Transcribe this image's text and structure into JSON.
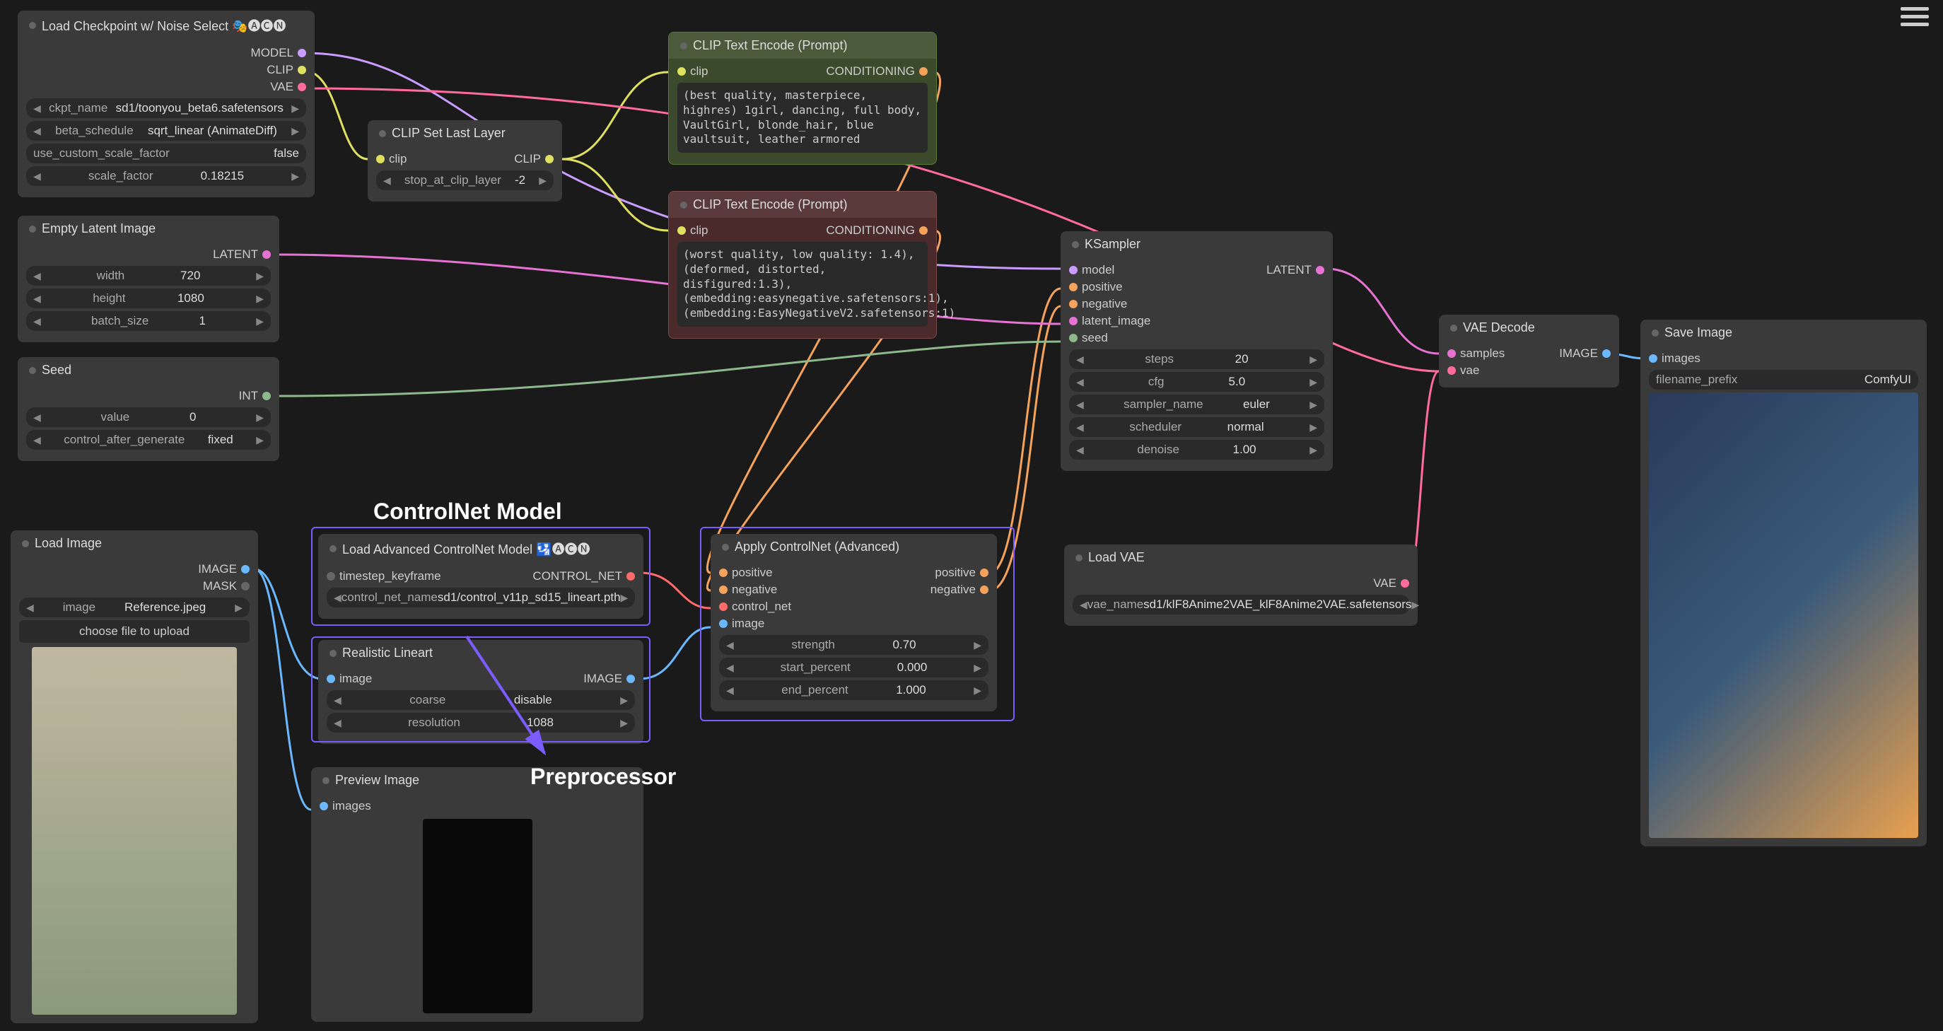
{
  "annotations": {
    "controlnet": "ControlNet Model",
    "preprocessor": "Preprocessor"
  },
  "nodes": {
    "loadckpt": {
      "title": "Load Checkpoint w/ Noise Select 🎭🅐🅒🅝",
      "outputs": [
        "MODEL",
        "CLIP",
        "VAE"
      ],
      "widgets": [
        {
          "label": "ckpt_name",
          "value": "sd1/toonyou_beta6.safetensors"
        },
        {
          "label": "beta_schedule",
          "value": "sqrt_linear (AnimateDiff)"
        },
        {
          "label": "use_custom_scale_factor",
          "value": "false"
        },
        {
          "label": "scale_factor",
          "value": "0.18215"
        }
      ]
    },
    "empty": {
      "title": "Empty Latent Image",
      "outputs": [
        "LATENT"
      ],
      "widgets": [
        {
          "label": "width",
          "value": "720"
        },
        {
          "label": "height",
          "value": "1080"
        },
        {
          "label": "batch_size",
          "value": "1"
        }
      ]
    },
    "seed": {
      "title": "Seed",
      "outputs": [
        "INT"
      ],
      "widgets": [
        {
          "label": "value",
          "value": "0"
        },
        {
          "label": "control_after_generate",
          "value": "fixed"
        }
      ]
    },
    "clipset": {
      "title": "CLIP Set Last Layer",
      "inputs": [
        "clip"
      ],
      "outputs": [
        "CLIP"
      ],
      "widgets": [
        {
          "label": "stop_at_clip_layer",
          "value": "-2"
        }
      ]
    },
    "clippos": {
      "title": "CLIP Text Encode (Prompt)",
      "inputs": [
        "clip"
      ],
      "outputs": [
        "CONDITIONING"
      ],
      "text": "(best quality, masterpiece, highres) 1girl, dancing, full body, VaultGirl, blonde_hair, blue vaultsuit, leather armored"
    },
    "clipneg": {
      "title": "CLIP Text Encode (Prompt)",
      "inputs": [
        "clip"
      ],
      "outputs": [
        "CONDITIONING"
      ],
      "text": "(worst quality, low quality: 1.4), (deformed, distorted, disfigured:1.3), (embedding:easynegative.safetensors:1), (embedding:EasyNegativeV2.safetensors:1)"
    },
    "ksampler": {
      "title": "KSampler",
      "inputs": [
        "model",
        "positive",
        "negative",
        "latent_image",
        "seed"
      ],
      "outputs": [
        "LATENT"
      ],
      "widgets": [
        {
          "label": "steps",
          "value": "20"
        },
        {
          "label": "cfg",
          "value": "5.0"
        },
        {
          "label": "sampler_name",
          "value": "euler"
        },
        {
          "label": "scheduler",
          "value": "normal"
        },
        {
          "label": "denoise",
          "value": "1.00"
        }
      ]
    },
    "vaedecode": {
      "title": "VAE Decode",
      "inputs": [
        "samples",
        "vae"
      ],
      "outputs": [
        "IMAGE"
      ]
    },
    "saveimage": {
      "title": "Save Image",
      "inputs": [
        "images"
      ],
      "widgets": [
        {
          "label": "filename_prefix",
          "value": "ComfyUI"
        }
      ]
    },
    "loadvae": {
      "title": "Load VAE",
      "outputs": [
        "VAE"
      ],
      "widgets": [
        {
          "label": "vae_name",
          "value": "sd1/klF8Anime2VAE_klF8Anime2VAE.safetensors"
        }
      ]
    },
    "loadimage": {
      "title": "Load Image",
      "outputs": [
        "IMAGE",
        "MASK"
      ],
      "widgets": [
        {
          "label": "image",
          "value": "Reference.jpeg"
        }
      ],
      "button": "choose file to upload"
    },
    "loadadvcn": {
      "title": "Load Advanced ControlNet Model 🛂🅐🅒🅝",
      "inputs": [
        "timestep_keyframe"
      ],
      "outputs": [
        "CONTROL_NET"
      ],
      "widgets": [
        {
          "label": "control_net_name",
          "value": "sd1/control_v11p_sd15_lineart.pth"
        }
      ]
    },
    "lineart": {
      "title": "Realistic Lineart",
      "inputs": [
        "image"
      ],
      "outputs": [
        "IMAGE"
      ],
      "widgets": [
        {
          "label": "coarse",
          "value": "disable"
        },
        {
          "label": "resolution",
          "value": "1088"
        }
      ]
    },
    "applycn": {
      "title": "Apply ControlNet (Advanced)",
      "inputs": [
        "positive",
        "negative",
        "control_net",
        "image"
      ],
      "outputs": [
        "positive",
        "negative"
      ],
      "widgets": [
        {
          "label": "strength",
          "value": "0.70"
        },
        {
          "label": "start_percent",
          "value": "0.000"
        },
        {
          "label": "end_percent",
          "value": "1.000"
        }
      ]
    },
    "preview": {
      "title": "Preview Image",
      "inputs": [
        "images"
      ]
    }
  }
}
